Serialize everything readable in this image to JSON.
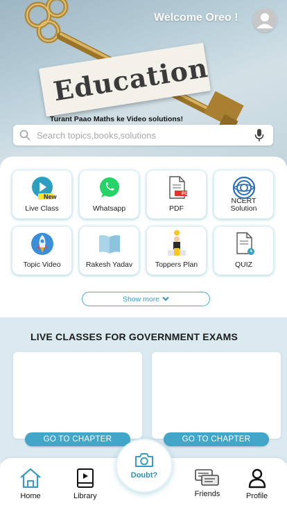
{
  "header": {
    "welcome": "Welcome Oreo !",
    "tagline": "Turant Paao Maths ke Video solutions!",
    "banner_word": "Education"
  },
  "search": {
    "placeholder": "Search topics,books,solutions"
  },
  "features": [
    {
      "label": "Live Class",
      "icon": "play-icon",
      "badge": "New"
    },
    {
      "label": "Whatsapp",
      "icon": "whatsapp-icon"
    },
    {
      "label": "PDF",
      "icon": "pdf-icon",
      "badge": "PDF"
    },
    {
      "label": "NCERT Solution",
      "icon": "ncert-icon"
    },
    {
      "label": "Topic Video",
      "icon": "rocket-icon"
    },
    {
      "label": "Rakesh Yadav",
      "icon": "book-icon"
    },
    {
      "label": "Toppers Plan",
      "icon": "trophy-icon"
    },
    {
      "label": "QUIZ",
      "icon": "quiz-icon"
    }
  ],
  "show_more": "Show more",
  "live": {
    "title": "LIVE CLASSES FOR GOVERNMENT EXAMS",
    "cards": [
      {
        "button": "GO TO CHAPTER"
      },
      {
        "button": "GO TO CHAPTER"
      }
    ]
  },
  "nav": {
    "home": "Home",
    "library": "Library",
    "doubt": "Doubt?",
    "friends": "Friends",
    "profile": "Profile"
  },
  "colors": {
    "accent": "#42a6c9",
    "whatsapp": "#25d366",
    "hero": "#b9cfd9"
  }
}
